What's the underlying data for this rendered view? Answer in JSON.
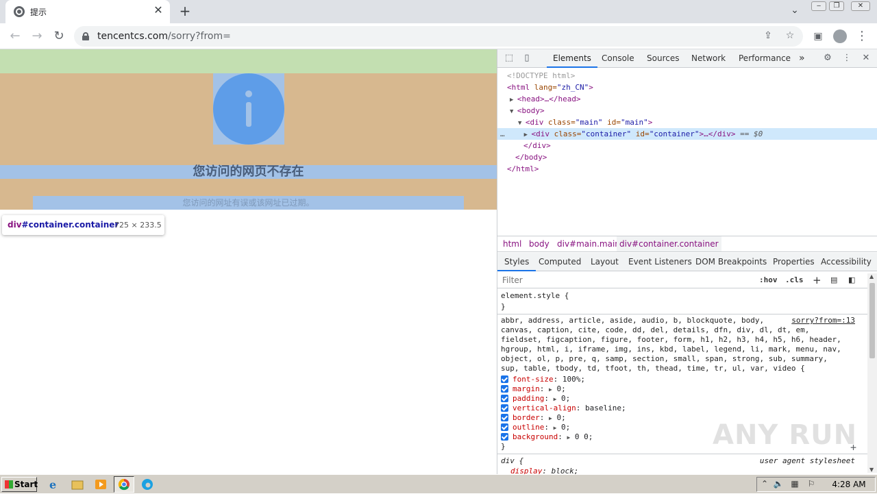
{
  "browser": {
    "tab_title": "提示",
    "url_host": "tencentcs.com",
    "url_path": "/sorry?from=",
    "icons": [
      "back-icon",
      "forward-icon",
      "reload-icon",
      "lock-icon",
      "share-icon",
      "star-icon",
      "sidepanel-icon",
      "profile-icon",
      "menu-icon"
    ]
  },
  "page": {
    "heading": "您访问的网页不存在",
    "subtext": "您访问的网址有误或该网址已过期。",
    "colors": {
      "margin_green": "#c3dfb1",
      "padding_tan": "#d7b88f",
      "content_blue": "#a3c2e7",
      "icon_blue": "#5e9de8"
    }
  },
  "tooltip": {
    "selector_tag": "div",
    "selector_rest": "#container.container",
    "dimensions": "725 × 233.5"
  },
  "devtools": {
    "tabs": [
      "Elements",
      "Console",
      "Sources",
      "Network",
      "Performance"
    ],
    "active_tab": "Elements",
    "more": "»",
    "dom": {
      "doctype": "<!DOCTYPE html>",
      "html_open_tag": "<html",
      "html_lang_attr": " lang=",
      "html_lang_val": "\"zh_CN\"",
      "html_close_bracket": ">",
      "head": "<head>…</head>",
      "body_open": "<body>",
      "main_open_tag": "<div",
      "main_class_attr": " class=",
      "main_class_val": "\"main\"",
      "main_id_attr": " id=",
      "main_id_val": "\"main\"",
      "main_close_bracket": ">",
      "container_open_tag": "<div",
      "container_class_attr": " class=",
      "container_class_val": "\"container\"",
      "container_id_attr": " id=",
      "container_id_val": "\"container\"",
      "container_rest": ">…</div>",
      "container_eq": " == $0",
      "div_close": "</div>",
      "body_close": "</body>",
      "html_close": "</html>",
      "ellipsis": "…"
    },
    "breadcrumbs": [
      "html",
      "body",
      "div#main.main",
      "div#container.container"
    ],
    "subtabs": [
      "Styles",
      "Computed",
      "Layout",
      "Event Listeners",
      "DOM Breakpoints",
      "Properties",
      "Accessibility"
    ],
    "filter_placeholder": "Filter",
    "hov": ":hov",
    "cls": ".cls",
    "styles": {
      "element_style": "element.style {",
      "close_brace": "}",
      "source": "sorry?from=:13",
      "selector_lines": [
        "abbr, address, article, aside, audio, b, blockquote, body,",
        "canvas, caption, cite, code, dd, del, details, dfn, div, dl, dt, em,",
        "fieldset, figcaption, figure, footer, form, h1, h2, h3, h4, h5, h6, header,",
        "hgroup, html, i, iframe, img, ins, kbd, label, legend, li, mark, menu, nav,",
        "object, ol, p, pre, q, samp, section, small, span, strong, sub, summary,",
        "sup, table, tbody, td, tfoot, th, thead, time, tr, ul, var, video {"
      ],
      "props": [
        {
          "name": "font-size",
          "value": " 100%;",
          "expand": false
        },
        {
          "name": "margin",
          "value": " 0;",
          "expand": true
        },
        {
          "name": "padding",
          "value": " 0;",
          "expand": true
        },
        {
          "name": "vertical-align",
          "value": " baseline;",
          "expand": false
        },
        {
          "name": "border",
          "value": " 0;",
          "expand": true
        },
        {
          "name": "outline",
          "value": " 0;",
          "expand": true
        },
        {
          "name": "background",
          "value": " 0 0;",
          "expand": true
        }
      ],
      "ua_selector": "div {",
      "ua_label": "user agent stylesheet",
      "ua_prop_name": "display",
      "ua_prop_value": ": block;"
    }
  },
  "watermark": "ANY RUN",
  "taskbar": {
    "start_label": "Start",
    "clock": "4:28 AM",
    "icons": [
      "ie-icon",
      "explorer-icon",
      "media-player-icon",
      "chrome-icon",
      "edge-icon"
    ]
  }
}
